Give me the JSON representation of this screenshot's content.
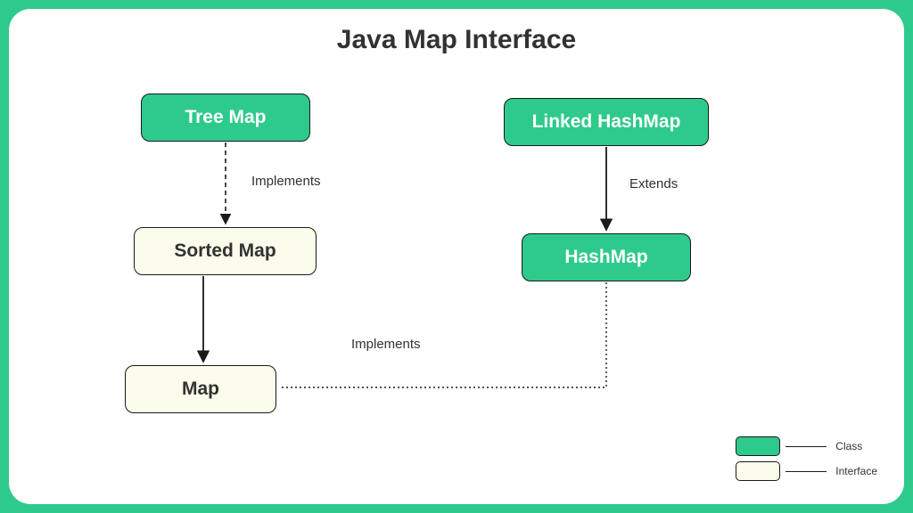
{
  "title": "Java Map Interface",
  "nodes": {
    "treemap": {
      "label": "Tree Map",
      "type": "class"
    },
    "linkedhashmap": {
      "label": "Linked HashMap",
      "type": "class"
    },
    "sortedmap": {
      "label": "Sorted Map",
      "type": "interface"
    },
    "hashmap": {
      "label": "HashMap",
      "type": "class"
    },
    "map": {
      "label": "Map",
      "type": "interface"
    }
  },
  "edges": {
    "treemap_sortedmap": {
      "label": "Implements",
      "style": "dashed"
    },
    "linkedhashmap_hashmap": {
      "label": "Extends",
      "style": "solid"
    },
    "sortedmap_map": {
      "label": "",
      "style": "solid"
    },
    "hashmap_map": {
      "label": "Implements",
      "style": "dotted"
    }
  },
  "legend": {
    "class_label": "Class",
    "interface_label": "Interface"
  },
  "colors": {
    "class_bg": "#2eca8b",
    "interface_bg": "#fbfceb",
    "border": "#1a1a1a"
  }
}
